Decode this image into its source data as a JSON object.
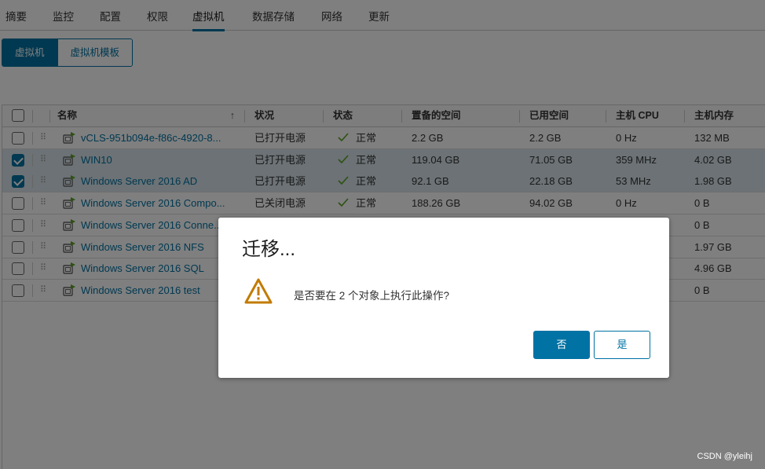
{
  "tabs": [
    {
      "label": "摘要"
    },
    {
      "label": "监控"
    },
    {
      "label": "配置"
    },
    {
      "label": "权限"
    },
    {
      "label": "虚拟机",
      "active": true
    },
    {
      "label": "数据存储"
    },
    {
      "label": "网络"
    },
    {
      "label": "更新"
    }
  ],
  "view_toggle": {
    "vms": "虚拟机",
    "templates": "虚拟机模板"
  },
  "grid": {
    "columns": {
      "name": "名称",
      "state": "状况",
      "status": "状态",
      "provisioned": "置备的空间",
      "used": "已用空间",
      "cpu": "主机 CPU",
      "mem": "主机内存"
    },
    "sort_icon": "↑",
    "rows": [
      {
        "name": "vCLS-951b094e-f86c-4920-8...",
        "state": "已打开电源",
        "status": "正常",
        "provisioned": "2.2 GB",
        "used": "2.2 GB",
        "cpu": "0 Hz",
        "mem": "132 MB",
        "selected": false
      },
      {
        "name": "WIN10",
        "state": "已打开电源",
        "status": "正常",
        "provisioned": "119.04 GB",
        "used": "71.05 GB",
        "cpu": "359 MHz",
        "mem": "4.02 GB",
        "selected": true
      },
      {
        "name": "Windows Server 2016 AD",
        "state": "已打开电源",
        "status": "正常",
        "provisioned": "92.1 GB",
        "used": "22.18 GB",
        "cpu": "53 MHz",
        "mem": "1.98 GB",
        "selected": true
      },
      {
        "name": "Windows Server 2016 Compo...",
        "state": "已关闭电源",
        "status": "正常",
        "provisioned": "188.26 GB",
        "used": "94.02 GB",
        "cpu": "0 Hz",
        "mem": "0 B",
        "selected": false
      },
      {
        "name": "Windows Server 2016 Conne...",
        "state": "",
        "status": "",
        "provisioned": "",
        "used": "",
        "cpu": "",
        "mem": "0 B",
        "selected": false
      },
      {
        "name": "Windows Server 2016 NFS",
        "state": "",
        "status": "",
        "provisioned": "",
        "used": "",
        "cpu": "",
        "mem": "1.97 GB",
        "selected": false
      },
      {
        "name": "Windows Server 2016 SQL",
        "state": "",
        "status": "",
        "provisioned": "",
        "used": "",
        "cpu": "",
        "mem": "4.96 GB",
        "selected": false
      },
      {
        "name": "Windows Server 2016 test",
        "state": "",
        "status": "",
        "provisioned": "",
        "used": "",
        "cpu": "",
        "mem": "0 B",
        "selected": false
      }
    ]
  },
  "dialog": {
    "title": "迁移...",
    "message": "是否要在 2 个对象上执行此操作?",
    "primary_label": "否",
    "secondary_label": "是",
    "icon": "warning-icon"
  },
  "colors": {
    "accent": "#0072a3",
    "warning": "#c27b00",
    "ok": "#5aa220"
  },
  "watermark": "CSDN @yleihj"
}
